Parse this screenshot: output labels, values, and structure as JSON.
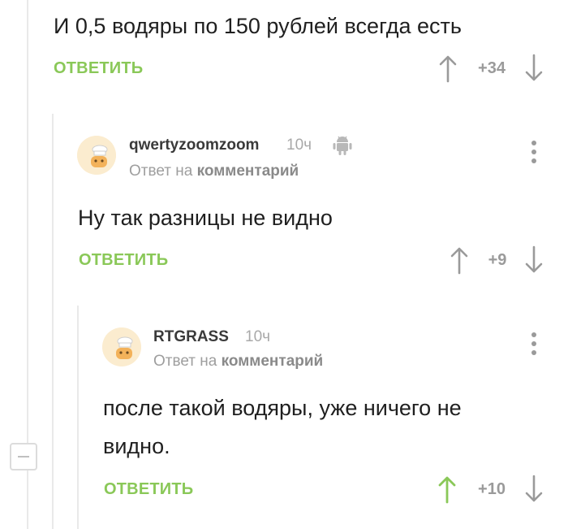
{
  "colors": {
    "reply_green": "#8ac858",
    "upvote_active": "#8ac858",
    "arrow_gray": "#9a9a9a",
    "thread_line": "#e9e9e9"
  },
  "comments": [
    {
      "text": "И 0,5 водяры по 150 рублей всегда есть",
      "reply_label": "ОТВЕТИТЬ",
      "score": "+34",
      "upvoted": false
    },
    {
      "username": "qwertyzoomzoom",
      "time": "10ч",
      "platform_icon": "android-icon",
      "reply_to_prefix": "Ответ на",
      "reply_to_link": "комментарий",
      "text": "Ну так разницы не видно",
      "reply_label": "ОТВЕТИТЬ",
      "score": "+9",
      "upvoted": false
    },
    {
      "username": "RTGRASS",
      "time": "10ч",
      "reply_to_prefix": "Ответ на",
      "reply_to_link": "комментарий",
      "text_line1": "после такой водяры, уже ничего не",
      "text_line2": "видно.",
      "reply_label": "ОТВЕТИТЬ",
      "score": "+10",
      "upvoted": true
    }
  ],
  "icons": {
    "upvote": "arrow-up-icon",
    "downvote": "arrow-down-icon",
    "more": "more-vertical-icon",
    "collapse": "minus-icon",
    "avatar": "default-avatar-icon"
  }
}
